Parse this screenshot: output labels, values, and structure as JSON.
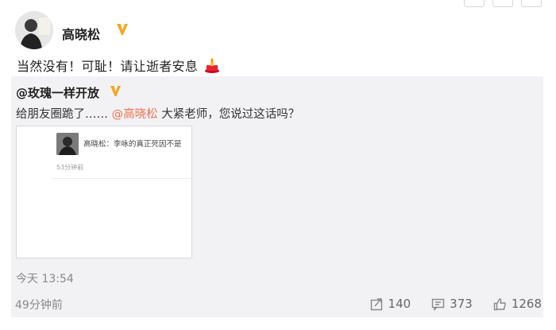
{
  "post": {
    "author": "高晓松",
    "text": "当然没有！可耻！请让逝者安息",
    "time": "49分钟前",
    "stats": {
      "repost": "140",
      "comment": "373",
      "like": "1268"
    }
  },
  "repost": {
    "author": "@玫瑰一样开放",
    "text_before": "给朋友圈跪了……",
    "mention": "@高晓松",
    "text_after": "大紧老师，您说过这话吗？",
    "time": "今天 13:54",
    "thumbnail": {
      "line": "高晓松：李咏的真正死因不是",
      "time": "53分钟前"
    }
  },
  "colors": {
    "mention": "#eb7350",
    "verified": "#f5a623"
  },
  "icons": [
    "verified-badge-icon",
    "candle-icon",
    "repost-icon",
    "comment-icon",
    "like-icon"
  ]
}
